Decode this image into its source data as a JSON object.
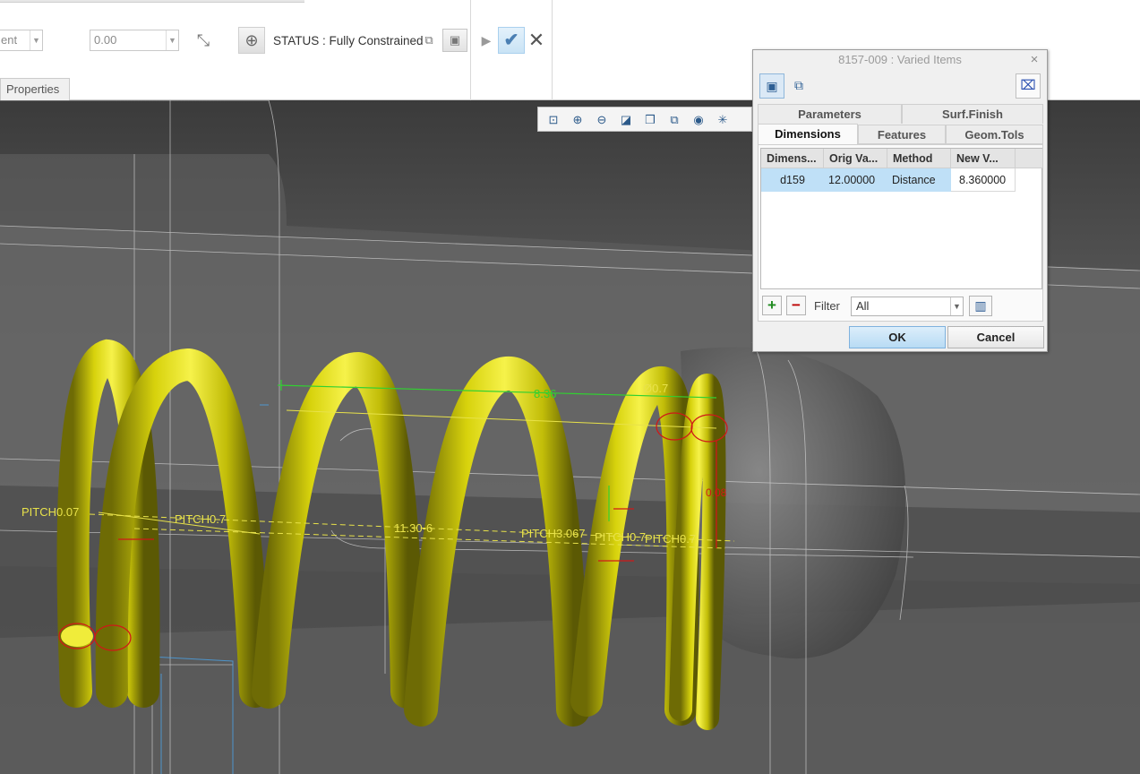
{
  "ribbon": {
    "reference_combo": "ent",
    "value_combo": "0.00",
    "status_text": "STATUS : Fully Constrained",
    "properties_tab": "Properties"
  },
  "viewport": {
    "annotations": {
      "pitch_left": "PITCH0.7",
      "pitch_left_overlap": "PITCH0.07",
      "pitch_mid": "PITCH0.7",
      "length_dim": "11.30-6",
      "pitch_right": "PITCH3.067",
      "pitch_right_overlap": "PITCH0.7",
      "pitch_right_end": "PITCH0.7",
      "top_dim": "8.36",
      "wire_dia": "Ø0.7",
      "end_dim": "0.08"
    },
    "colors": {
      "spring": "#d9d20a",
      "background": "#6e6e6e",
      "dim_green": "#31d131",
      "dim_red": "#d01818",
      "dim_yellow": "#e8e24a"
    }
  },
  "view_toolbar": {
    "icons": [
      "zoom-fit-icon",
      "zoom-in-icon",
      "zoom-out-icon",
      "repaint-icon",
      "display-style-icon",
      "saved-views-icon",
      "capture-icon",
      "datum-display-icon"
    ]
  },
  "dialog": {
    "title": "8157-009 : Varied Items",
    "close": "×",
    "tabs_row1": [
      "Parameters",
      "Surf.Finish"
    ],
    "tabs_row2": [
      "Dimensions",
      "Features",
      "Geom.Tols"
    ],
    "columns": [
      "Dimens...",
      "Orig Va...",
      "Method",
      "New V..."
    ],
    "rows": [
      {
        "dimension": "d159",
        "orig_value": "12.00000",
        "method": "Distance",
        "new_value": "8.360000"
      }
    ],
    "filter_label": "Filter",
    "filter_value": "All",
    "ok": "OK",
    "cancel": "Cancel"
  }
}
